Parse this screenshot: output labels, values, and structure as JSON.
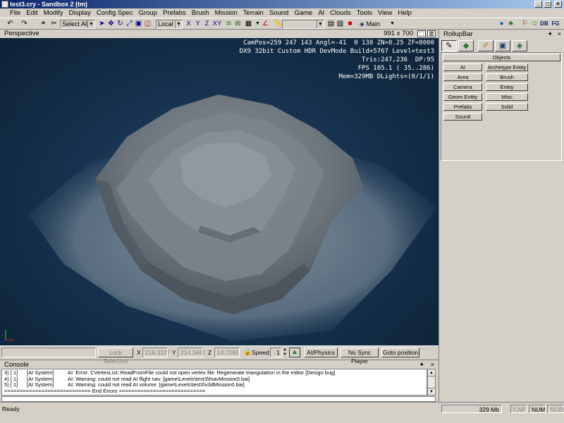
{
  "window": {
    "title": "test3.cry - Sandbox 2 (tm)"
  },
  "menu": [
    "File",
    "Edit",
    "Modify",
    "Display",
    "Config Spec",
    "Group",
    "Prefabs",
    "Brush",
    "Mission",
    "Terrain",
    "Sound",
    "Game",
    "AI",
    "Clouds",
    "Tools",
    "View",
    "Help"
  ],
  "toolbar": {
    "selection_filter": "Select All",
    "coord_system": "Local",
    "axes": [
      "X",
      "Y",
      "Z",
      "XY"
    ],
    "layer": "Main"
  },
  "viewport": {
    "title": "Perspective",
    "resolution": "991 x 700",
    "stats": [
      "CamPos=259 247 143 Angl=-41  0 138 ZN=0.25 ZF=8000",
      "DX9 32bit Custom HDR DevMode Build=5767 Level=test3",
      "Tris:247,236  DP:95",
      "FPS 105.1 ( 35..286)",
      "Mem=329MB DLights=(0/1/1)"
    ]
  },
  "viewport_status": {
    "lock_selection": "Lock Selection",
    "x_label": "X",
    "x_value": "216.3227",
    "y_label": "Y",
    "y_value": "214.3462",
    "z_label": "Z",
    "z_value": "14.7265",
    "speed_label": "Speed:",
    "speed_value": "1",
    "ai_physics": "AI/Physics",
    "no_sync_player": "No Sync Player",
    "goto_position": "Goto position"
  },
  "console": {
    "title": "Console",
    "rows": [
      {
        "n": "3) [ 1]",
        "src": "[AI System]",
        "msg": "AI: Error: CVertexList::ReadFromFile could not open vertex file: Regenerate triangulation in the editor [Design bug]"
      },
      {
        "n": "4) [ 1]",
        "src": "[AI System]",
        "msg": "AI: Warning: could not read AI flight nav. [game\\Levels\\test3\\fnavMission0.bai]"
      },
      {
        "n": "5) [ 1]",
        "src": "[AI System]",
        "msg": "AI: Warning: could not read AI volume. [game\\Levels\\test3\\v3dMission0.bai]"
      }
    ],
    "footer": "============================ End Errors ============================"
  },
  "status_bar": {
    "text": "Ready",
    "memory": "329 Mb",
    "cap": "CAP",
    "num": "NUM",
    "scrl": "SCRL"
  },
  "rollup": {
    "title": "RollupBar",
    "objects_header": "Objects",
    "buttons": [
      "AI",
      "Archetype Entity",
      "Area",
      "Brush",
      "Camera",
      "Entity",
      "Geom Entity",
      "Misc",
      "Prefabs",
      "Solid",
      "Sound"
    ]
  }
}
